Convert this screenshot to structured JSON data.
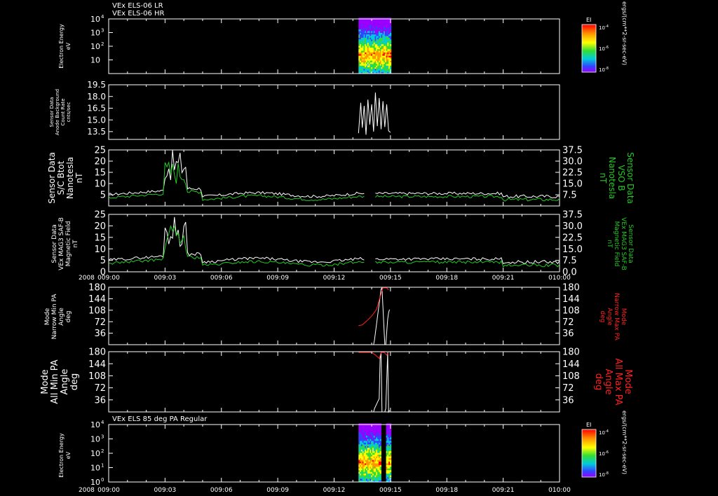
{
  "chart_data": [
    {
      "type": "heatmap",
      "titles": [
        "VEx ELS-06 LR",
        "VEx ELS-06 HR"
      ],
      "ylabel": [
        "Electron Energy",
        "eV"
      ],
      "yscale": "log",
      "ylim": [
        1,
        10000
      ],
      "ticks": [
        "10",
        "10",
        "10",
        "10"
      ],
      "tick_exp": [
        "4",
        "3",
        "2",
        ""
      ],
      "tick_vals": [
        10000,
        1000,
        100,
        10
      ],
      "data_window": [
        "09:13:18",
        "09:15:00"
      ],
      "colorbar": {
        "label": "EI",
        "ticks": [
          "10",
          "10",
          "10"
        ],
        "exps": [
          "-4",
          "-6",
          "-8"
        ],
        "unit": "ergs/(cm**2-sr-sec-eV)"
      }
    },
    {
      "type": "line",
      "ylabel": [
        "Sensor Data",
        "Anode Background",
        "Count Rate",
        "cnts/sec"
      ],
      "ylim": [
        12.5,
        19.5
      ],
      "ticks": [
        "19.5",
        "18.0",
        "16.5",
        "15.0",
        "13.5"
      ],
      "tick_vals": [
        19.5,
        18.0,
        16.5,
        15.0,
        13.5
      ],
      "series": [
        {
          "color": "#ffffff",
          "x": [
            "09:13:18",
            "09:13:25",
            "09:13:30",
            "09:13:36",
            "09:13:42",
            "09:13:48",
            "09:13:54",
            "09:14:00",
            "09:14:06",
            "09:14:12",
            "09:14:18",
            "09:14:24",
            "09:14:30",
            "09:14:36",
            "09:14:42",
            "09:14:48",
            "09:14:54",
            "09:15:00"
          ],
          "y": [
            13.3,
            17.2,
            14.0,
            16.8,
            13.1,
            17.6,
            14.4,
            17.0,
            13.5,
            18.5,
            14.2,
            17.8,
            13.8,
            17.4,
            14.1,
            17.0,
            13.6,
            13.4
          ]
        }
      ]
    },
    {
      "type": "line",
      "ylabel": [
        "Sensor Data",
        "S/C Btot",
        "Nanotesla",
        "nT"
      ],
      "ylabel_right": [
        "Sensor Data",
        "VSO B",
        "Nanotesla",
        "nT"
      ],
      "ylim": [
        0,
        25
      ],
      "ticks": [
        "25",
        "20",
        "15",
        "10",
        "5"
      ],
      "tick_vals": [
        25,
        20,
        15,
        10,
        5
      ],
      "ylim_right": [
        0,
        37.5
      ],
      "ticks_right": [
        "37.5",
        "30.0",
        "22.5",
        "15.0",
        "7.5"
      ],
      "tick_vals_right": [
        37.5,
        30.0,
        22.5,
        15.0,
        7.5
      ]
    },
    {
      "type": "line",
      "ylabel": [
        "Sensor Data",
        "VEx MAG3 SAF-B",
        "Magnetic Field",
        "nT"
      ],
      "ylabel_right": [
        "Sensor Data",
        "VEx MAG3 SAF-B",
        "Magnetic Field",
        "nT"
      ],
      "ylim": [
        0,
        25
      ],
      "ticks": [
        "25",
        "20",
        "15",
        "10",
        "5",
        "0"
      ],
      "tick_vals": [
        25,
        20,
        15,
        10,
        5,
        0
      ],
      "ylim_right": [
        0,
        37.5
      ],
      "ticks_right": [
        "37.5",
        "30.0",
        "22.5",
        "15.0",
        "7.5",
        "0.0"
      ],
      "tick_vals_right": [
        37.5,
        30.0,
        22.5,
        15.0,
        7.5,
        0
      ]
    },
    {
      "type": "line",
      "ylabel": [
        "Mode",
        "Narrow Min PA",
        "Angle",
        "deg"
      ],
      "ylabel_right": [
        "Mode",
        "Narrow Max PA",
        "Angle",
        "deg"
      ],
      "ylim": [
        0,
        180
      ],
      "ticks": [
        "180",
        "144",
        "108",
        "72",
        "36"
      ],
      "tick_vals": [
        180,
        144,
        108,
        72,
        36
      ],
      "ticks_right": [
        "180",
        "144",
        "108",
        "72",
        "36"
      ],
      "series": [
        {
          "color": "#ffffff",
          "x": [
            "09:13:18",
            "09:14:06",
            "09:14:09",
            "09:14:30",
            "09:14:33",
            "09:14:42",
            "09:14:45",
            "09:14:51",
            "09:14:54",
            "09:14:57"
          ],
          "y": [
            0,
            0,
            15,
            175,
            178,
            0,
            0,
            80,
            100,
            110
          ]
        },
        {
          "color": "#ff2020",
          "x": [
            "09:13:18",
            "09:13:30",
            "09:13:45",
            "09:14:00",
            "09:14:15",
            "09:14:30",
            "09:14:36",
            "09:14:48",
            "09:14:54"
          ],
          "y": [
            60,
            62,
            75,
            90,
            110,
            160,
            178,
            178,
            172
          ]
        }
      ]
    },
    {
      "type": "line",
      "ylabel": [
        "Mode",
        "All Min PA",
        "Angle",
        "deg"
      ],
      "ylabel_right": [
        "Mode",
        "All Max PA",
        "Angle",
        "deg"
      ],
      "ylim": [
        0,
        180
      ],
      "ticks": [
        "180",
        "144",
        "108",
        "72",
        "36"
      ],
      "tick_vals": [
        180,
        144,
        108,
        72,
        36
      ],
      "ticks_right": [
        "180",
        "144",
        "108",
        "72",
        "36"
      ],
      "series": [
        {
          "color": "#ffffff",
          "x": [
            "09:13:18",
            "09:14:06",
            "09:14:09",
            "09:14:24",
            "09:14:27",
            "09:14:30",
            "09:14:33",
            "09:14:42",
            "09:14:45",
            "09:14:51",
            "09:14:54",
            "09:14:57"
          ],
          "y": [
            0,
            0,
            10,
            40,
            160,
            175,
            0,
            0,
            10,
            178,
            0,
            5
          ]
        },
        {
          "color": "#ff2020",
          "x": [
            "09:13:18",
            "09:14:00",
            "09:14:12",
            "09:14:24",
            "09:14:30",
            "09:14:40",
            "09:14:48",
            "09:14:54"
          ],
          "y": [
            178,
            178,
            170,
            160,
            178,
            178,
            170,
            178
          ]
        }
      ]
    },
    {
      "type": "heatmap",
      "titles": [
        "VEx ELS 85 deg PA Regular"
      ],
      "ylabel": [
        "Electron Energy",
        "eV"
      ],
      "yscale": "log",
      "ylim": [
        1,
        10000
      ],
      "ticks": [
        "10",
        "10",
        "10",
        "10",
        "10"
      ],
      "tick_exp": [
        "4",
        "3",
        "2",
        "1",
        "0"
      ],
      "tick_vals": [
        10000,
        1000,
        100,
        10,
        1
      ],
      "data_window": [
        "09:13:18",
        "09:15:00"
      ],
      "colorbar": {
        "label": "EI",
        "ticks": [
          "10",
          "10",
          "10"
        ],
        "exps": [
          "-4",
          "-6",
          "-8"
        ],
        "unit": "ergs/(cm**2-sr-sec-eV)"
      }
    }
  ],
  "xaxis": {
    "year": "2008",
    "tick_labels": [
      "009:00",
      "009:03",
      "009:06",
      "009:09",
      "009:12",
      "009:15",
      "009:18",
      "009:21",
      "010:00"
    ],
    "range": [
      "09:00:00",
      "09:24:00"
    ]
  },
  "colors": {
    "background": "#000000",
    "axes": "#ffffff",
    "green": "#22cc22",
    "red": "#ff2020"
  }
}
